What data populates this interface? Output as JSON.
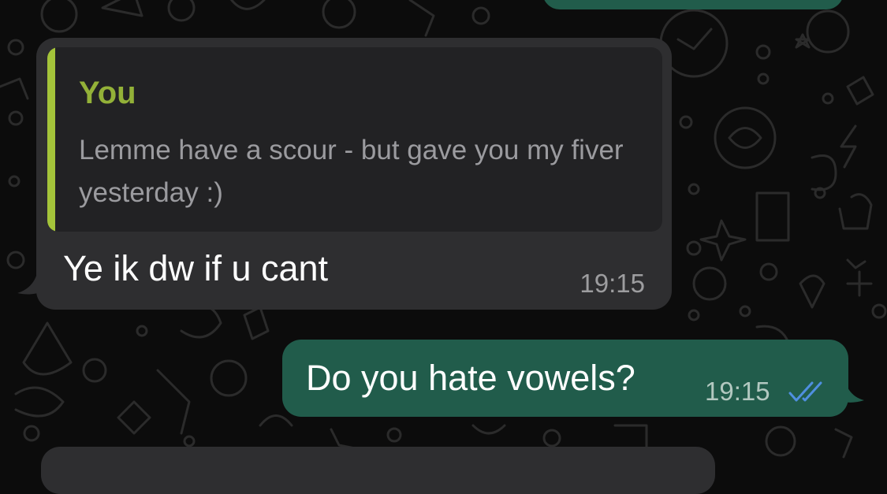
{
  "colors": {
    "background": "#0c0c0c",
    "incoming_bubble": "#2e2e30",
    "quote_background": "#222224",
    "quote_accent": "#a4c43a",
    "quote_author": "#93b138",
    "outgoing_bubble": "#215c4b",
    "read_ticks": "#4f8fe0"
  },
  "incoming_message": {
    "quote": {
      "author": "You",
      "text": "Lemme have a scour - but gave you my fiver yesterday :)"
    },
    "text": "Ye ik dw if u cant",
    "time": "19:15"
  },
  "outgoing_message": {
    "text": "Do you hate vowels?",
    "time": "19:15",
    "status_icon": "double-check-read-icon"
  }
}
